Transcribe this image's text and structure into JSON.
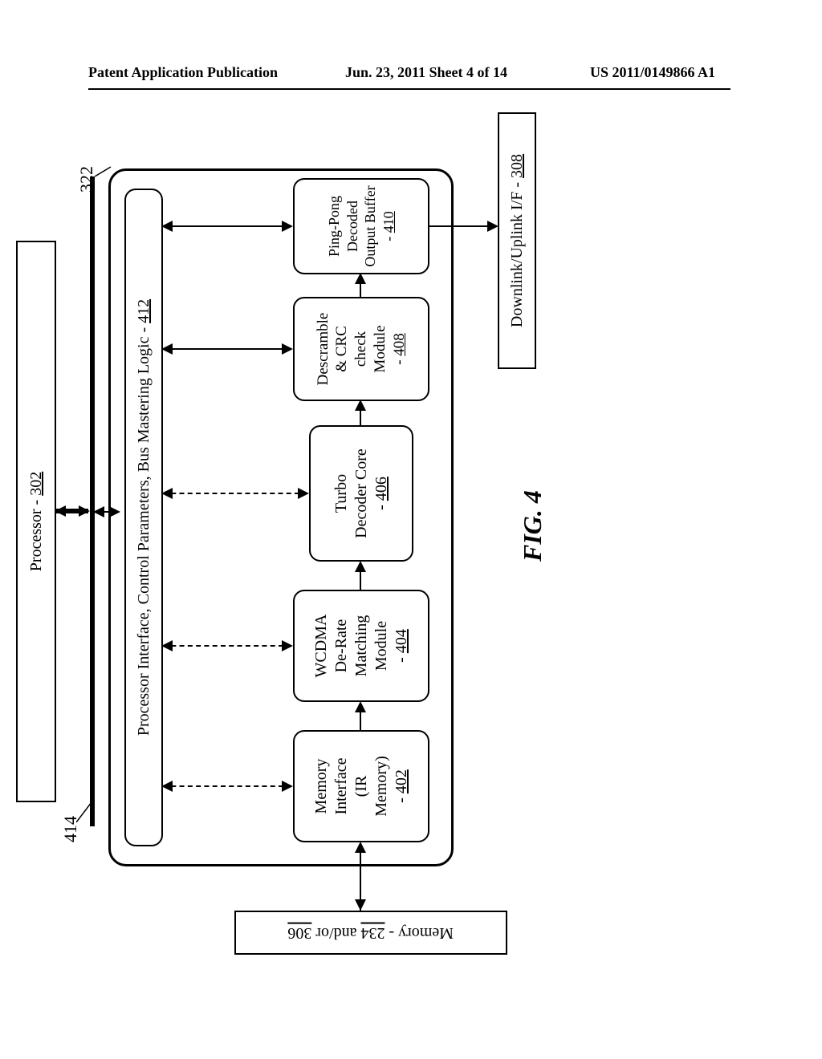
{
  "header": {
    "left": "Patent Application Publication",
    "center": "Jun. 23, 2011  Sheet 4 of 14",
    "right": "US 2011/0149866 A1"
  },
  "labels": {
    "callout322": "322",
    "callout414": "414",
    "fig": "FIG. 4"
  },
  "blocks": {
    "processor": {
      "text": "Processor - ",
      "ref": "302"
    },
    "piflogic": {
      "text": "Processor Interface, Control Parameters, Bus Mastering Logic - ",
      "ref": "412"
    },
    "memiface": {
      "l1": "Memory",
      "l2": "Interface",
      "l3": "(IR",
      "l4": "Memory)",
      "ref": "402"
    },
    "wcdma": {
      "l1": "WCDMA",
      "l2": "De-Rate",
      "l3": "Matching",
      "l4": "Module",
      "ref": "404"
    },
    "turbo": {
      "l1": "Turbo",
      "l2": "Decoder Core",
      "ref": "406"
    },
    "descr": {
      "l1": "Descramble",
      "l2": "& CRC",
      "l3": "check",
      "l4": "Module",
      "ref": "408"
    },
    "pingpong": {
      "l1": "Ping-Pong",
      "l2": "Decoded",
      "l3": "Output Buffer",
      "ref": "410"
    },
    "memory_pre": "Memory - ",
    "memory_ref1": "234",
    "memory_mid": " and/or ",
    "memory_ref2": "306",
    "dluplink": {
      "text": "Downlink/Uplink I/F - ",
      "ref": "308"
    }
  }
}
